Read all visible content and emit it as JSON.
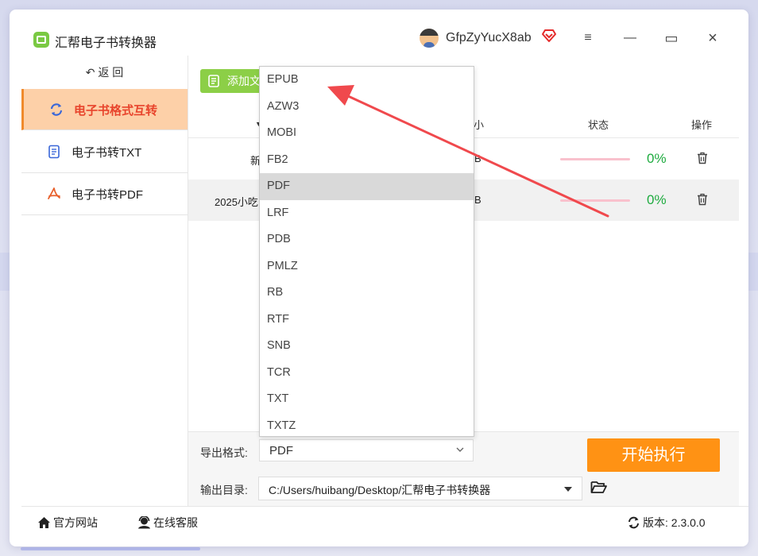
{
  "app": {
    "title": "汇帮电子书转换器",
    "username": "GfpZyYucX8ab"
  },
  "window_controls": {
    "menu": "≡",
    "minimize": "—",
    "maximize": "▭",
    "close": "×"
  },
  "sidebar": {
    "back_label": "返 回",
    "items": [
      {
        "label": "电子书格式互转",
        "active": true,
        "icon": "refresh-icon"
      },
      {
        "label": "电子书转TXT",
        "active": false,
        "icon": "document-icon"
      },
      {
        "label": "电子书转PDF",
        "active": false,
        "icon": "pdf-icon"
      }
    ]
  },
  "toolbar": {
    "add_label": "添加文件"
  },
  "table": {
    "headers": {
      "size": "小",
      "status": "状态",
      "action": "操作"
    },
    "rows": [
      {
        "name": "新",
        "size": "B",
        "progress": "0%",
        "progress_value": 0
      },
      {
        "name": "2025小吃",
        "size": "B",
        "progress": "0%",
        "progress_value": 0
      }
    ]
  },
  "export": {
    "format_label": "导出格式:",
    "format_value": "PDF",
    "output_label": "输出目录:",
    "output_value": "C:/Users/huibang/Desktop/汇帮电子书转换器",
    "start_label": "开始执行"
  },
  "dropdown": {
    "options": [
      "EPUB",
      "AZW3",
      "MOBI",
      "FB2",
      "PDF",
      "LRF",
      "PDB",
      "PMLZ",
      "RB",
      "RTF",
      "SNB",
      "TCR",
      "TXT",
      "TXTZ"
    ],
    "selected": "PDF"
  },
  "footer": {
    "website": "官方网站",
    "support": "在线客服",
    "version": "版本: 2.3.0.0"
  },
  "colors": {
    "accent": "#ff9214",
    "active_nav_bg": "#fdd0a8",
    "active_nav_text": "#e8442c",
    "progress": "#1eab3f",
    "add_button": "#8ccf47",
    "annotation_arrow": "#f0494d"
  }
}
